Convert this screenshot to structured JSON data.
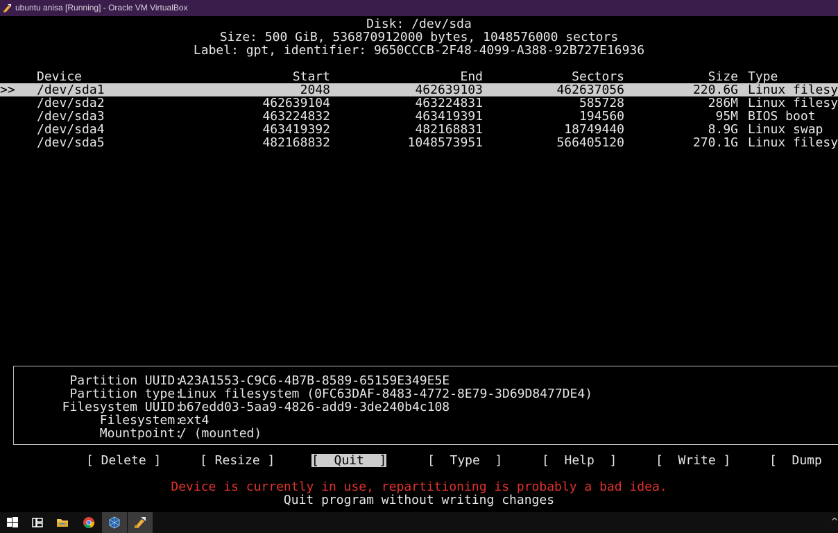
{
  "window": {
    "title": "ubuntu anisa [Running] - Oracle VM VirtualBox",
    "icon": "virtualbox-icon"
  },
  "disk": {
    "line1": "Disk: /dev/sda",
    "line2": "Size: 500 GiB, 536870912000 bytes, 1048576000 sectors",
    "line3": "Label: gpt, identifier: 9650CCCB-2F48-4099-A388-92B727E16936"
  },
  "table": {
    "headers": {
      "device": "Device",
      "start": "Start",
      "end": "End",
      "sectors": "Sectors",
      "size": "Size",
      "type": "Type"
    },
    "selection_marker": ">>",
    "selected_index": 0,
    "rows": [
      {
        "device": "/dev/sda1",
        "start": "2048",
        "end": "462639103",
        "sectors": "462637056",
        "size": "220.6G",
        "type": "Linux filesystem"
      },
      {
        "device": "/dev/sda2",
        "start": "462639104",
        "end": "463224831",
        "sectors": "585728",
        "size": "286M",
        "type": "Linux filesystem"
      },
      {
        "device": "/dev/sda3",
        "start": "463224832",
        "end": "463419391",
        "sectors": "194560",
        "size": "95M",
        "type": "BIOS boot"
      },
      {
        "device": "/dev/sda4",
        "start": "463419392",
        "end": "482168831",
        "sectors": "18749440",
        "size": "8.9G",
        "type": "Linux swap"
      },
      {
        "device": "/dev/sda5",
        "start": "482168832",
        "end": "1048573951",
        "sectors": "566405120",
        "size": "270.1G",
        "type": "Linux filesystem"
      }
    ]
  },
  "info": {
    "partition_uuid_label": "Partition UUID:",
    "partition_uuid": "A23A1553-C9C6-4B7B-8589-65159E349E5E",
    "partition_type_label": "Partition type:",
    "partition_type": "Linux filesystem (0FC63DAF-8483-4772-8E79-3D69D8477DE4)",
    "filesystem_uuid_label": "Filesystem UUID:",
    "filesystem_uuid": "b67edd03-5aa9-4826-add9-3de240b4c108",
    "filesystem_label": "Filesystem:",
    "filesystem": "ext4",
    "mountpoint_label": "Mountpoint:",
    "mountpoint": "/ (mounted)"
  },
  "menu": {
    "delete": "[ Delete ]",
    "resize": "[ Resize ]",
    "quit": "[  Quit  ]",
    "type": "[  Type  ]",
    "help": "[  Help  ]",
    "write": "[  Write ]",
    "dump": "[  Dump  ]",
    "active": "quit"
  },
  "status": {
    "warning": "Device is currently in use, repartitioning is probably a bad idea.",
    "hint": "Quit program without writing changes"
  },
  "taskbar": {
    "items": [
      "windows-start-icon",
      "task-view-icon",
      "file-explorer-icon",
      "chrome-icon",
      "virtualbox-manager-icon",
      "virtualbox-vm-icon"
    ],
    "tray_chevron": "^"
  },
  "colors": {
    "titlebar": "#3a1d4a",
    "terminal_bg": "#000000",
    "terminal_fg": "#e6e6e6",
    "highlight": "#cdcdcd",
    "warning": "#e2322c",
    "taskbar": "#101010"
  }
}
